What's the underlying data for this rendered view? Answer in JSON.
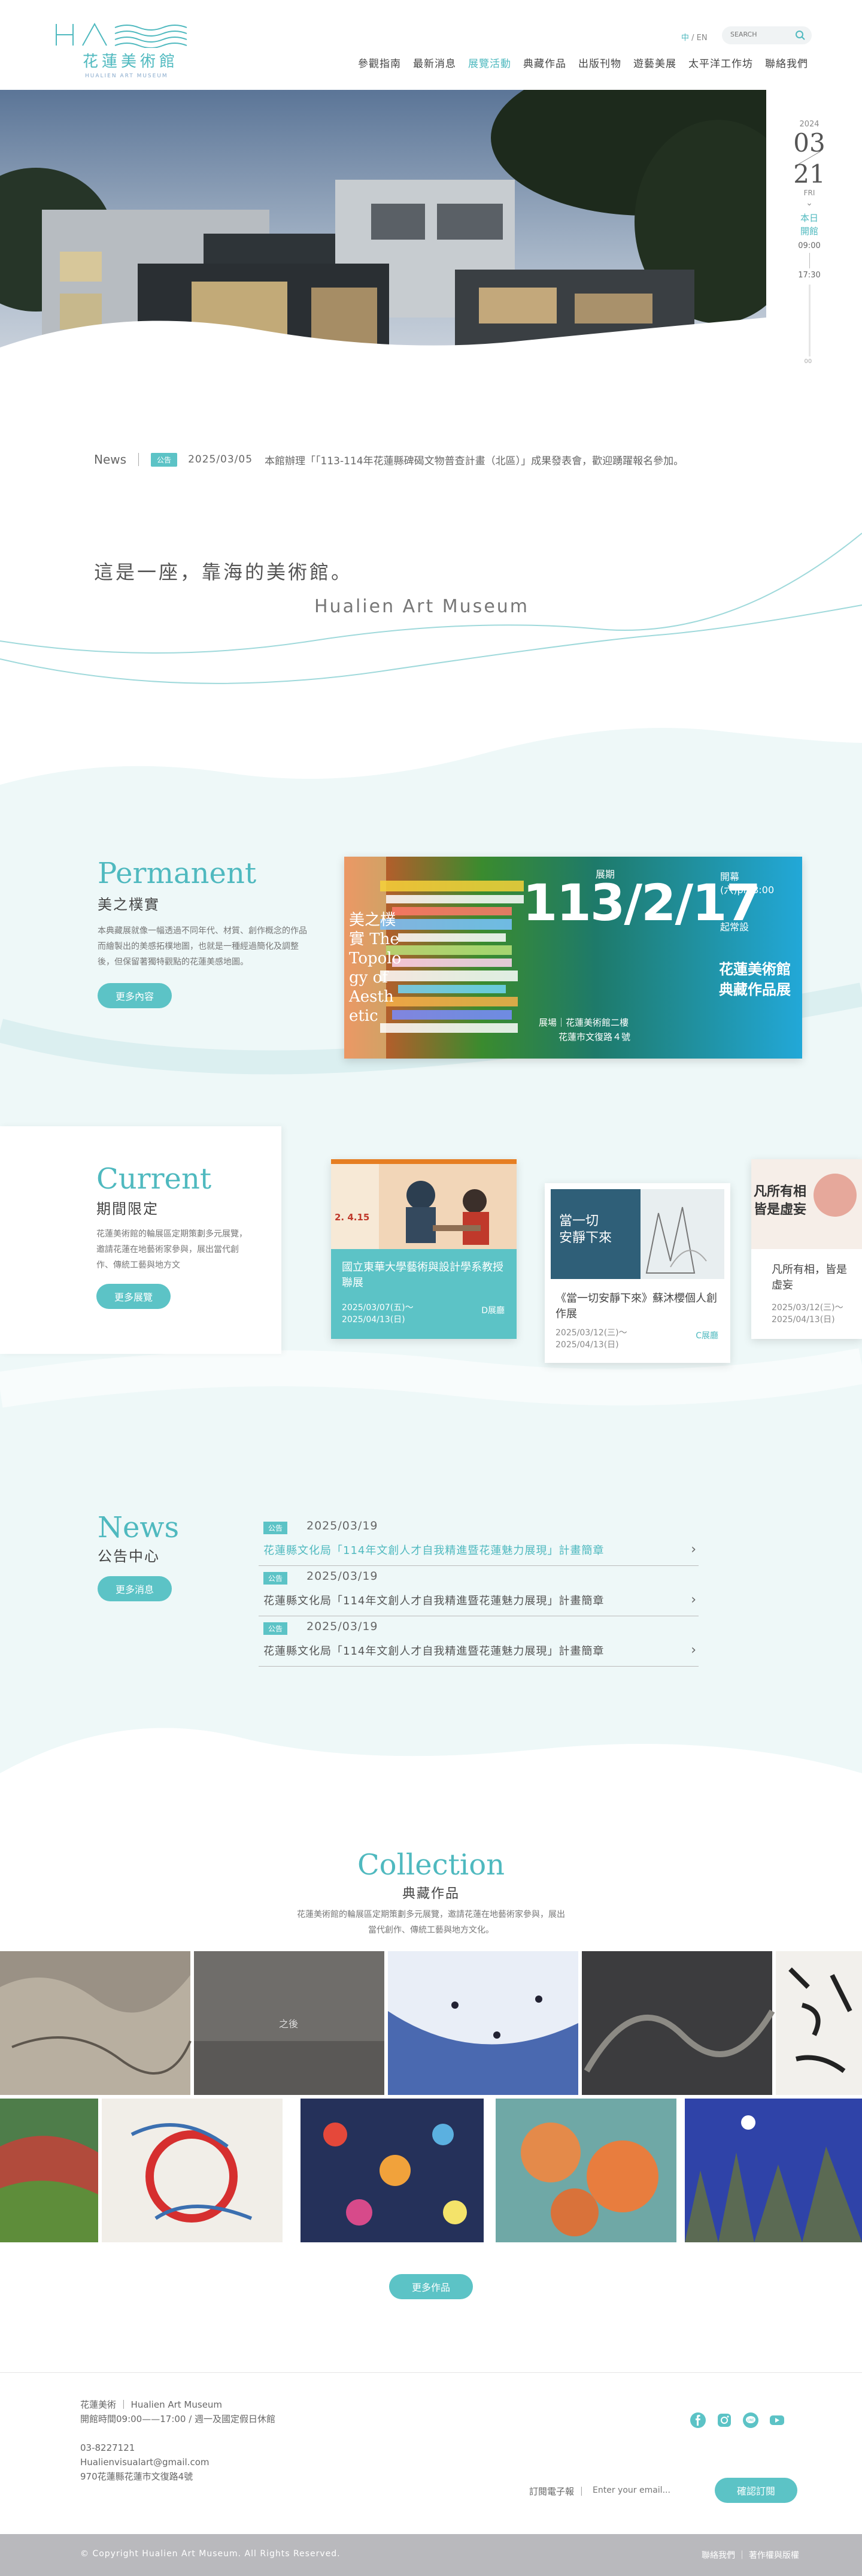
{
  "header": {
    "logo_cn": "花蓮美術館",
    "logo_en": "HUALIEN ART MUSEUM",
    "lang": {
      "zh": "中",
      "sep": " / ",
      "en": "EN"
    },
    "search_placeholder": "SEARCH",
    "nav": [
      {
        "label": "參觀指南",
        "active": false
      },
      {
        "label": "最新消息",
        "active": false
      },
      {
        "label": "展覽活動",
        "active": true
      },
      {
        "label": "典藏作品",
        "active": false
      },
      {
        "label": "出版刊物",
        "active": false
      },
      {
        "label": "遊藝美展",
        "active": false
      },
      {
        "label": "太平洋工作坊",
        "active": false
      },
      {
        "label": "聯絡我們",
        "active": false
      }
    ]
  },
  "date_panel": {
    "year": "2024",
    "month": "03",
    "day": "21",
    "weekday": "FRI",
    "status": "本日\n開館",
    "open": "09:00",
    "close": "17:30"
  },
  "ticker": {
    "label": "News",
    "tag": "公告",
    "date": "2025/03/05",
    "text": "本館辦理「「113-114年花蓮縣碑碣文物普查計畫（北區）」成果發表會，歡迎踴躍報名參加。"
  },
  "tagline": {
    "cn": "這是一座，靠海的美術館。",
    "en": "Hualien Art Museum"
  },
  "permanent": {
    "title_en": "Permanent",
    "title_cn": "美之樸實",
    "desc": "本典藏展就像一幅透過不同年代、材質、創作概念的作品而繪製出的美感拓樸地圖，也就是一種經過簡化及調整後，但保留著獨特觀點的花蓮美感地圖。",
    "button": "更多內容",
    "poster": {
      "big": "113/2/17",
      "small_top": "展期",
      "side1": "開幕",
      "side2": "(六)pm3:00",
      "side3": "起常設",
      "title1": "花蓮美術館",
      "title2": "典藏作品展",
      "left_text": "美之樸實 The Topology of Aesthetic",
      "venue1": "展場｜花蓮美術館二樓",
      "venue2": "花蓮市文復路４號"
    }
  },
  "current": {
    "title_en": "Current",
    "title_cn": "期間限定",
    "desc": "花蓮美術館的輪展區定期策劃多元展覽，邀請花蓮在地藝術家參與，展出當代創作、傳統工藝與地方文",
    "button": "更多展覽",
    "cards": [
      {
        "title": "國立東華大學藝術與設計學系教授聯展",
        "date": "2025/03/07(五)～\n2025/04/13(日)",
        "loc": "D展廳",
        "img_text": "2.  4.15",
        "featured": true
      },
      {
        "title": "《當一切安靜下來》蘇沐櫻個人創作展",
        "date": "2025/03/12(三)～\n2025/04/13(日)",
        "loc": "C展廳",
        "img_text": "當一切\n安靜下來",
        "featured": false
      },
      {
        "title": "凡所有相，皆是虛妄",
        "date": "2025/03/12(三)～\n2025/04/13(日)",
        "loc": "",
        "img_text": "凡所有相\n皆是虛妄",
        "featured": false
      }
    ]
  },
  "news": {
    "title_en": "News",
    "title_cn": "公告中心",
    "button": "更多消息",
    "items": [
      {
        "tag": "公告",
        "date": "2025/03/19",
        "title": "花蓮縣文化局「114年文創人才自我精進暨花蓮魅力展現」計畫簡章",
        "highlight": true
      },
      {
        "tag": "公告",
        "date": "2025/03/19",
        "title": "花蓮縣文化局「114年文創人才自我精進暨花蓮魅力展現」計畫簡章",
        "highlight": false
      },
      {
        "tag": "公告",
        "date": "2025/03/19",
        "title": "花蓮縣文化局「114年文創人才自我精進暨花蓮魅力展現」計畫簡章",
        "highlight": false
      }
    ]
  },
  "collection": {
    "title_en": "Collection",
    "title_cn": "典藏作品",
    "desc1": "花蓮美術館的輪展區定期策劃多元展覽，邀請花蓮在地藝術家參與，展出",
    "desc2": "當代創作、傳統工藝與地方文化。",
    "button": "更多作品",
    "tile_text": "之後"
  },
  "footer": {
    "name": "花蓮美術 ｜ Hualien Art Museum",
    "hours": "開館時間09:00——17:00 / 週一及國定假日休館",
    "phone": "03-8227121",
    "email": "Hualienvisualart@gmail.com",
    "address": "970花蓮縣花蓮市文復路4號",
    "subscribe_label": "訂閱電子報 ｜",
    "subscribe_placeholder": "Enter your email...",
    "subscribe_button": "確認訂閱",
    "copyright": "© Copyright Hualien Art Museum. All Rights Reserved.",
    "links": "聯絡我們 ｜ 著作權與版權",
    "social": [
      "facebook-icon",
      "instagram-icon",
      "line-icon",
      "youtube-icon"
    ]
  },
  "colors": {
    "accent": "#5cc3c6",
    "accent_text": "#4fb9bf",
    "footer_bar": "#b9b9bd"
  }
}
